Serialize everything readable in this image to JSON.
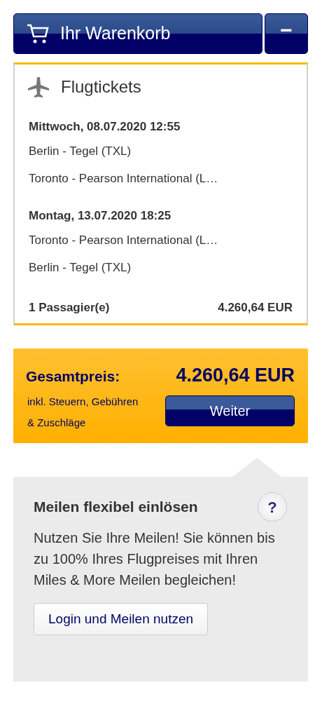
{
  "cart_header": {
    "title": "Ihr Warenkorb",
    "collapse_button": "−"
  },
  "flight_card": {
    "title": "Flugtickets",
    "segments": [
      {
        "datetime": "Mittwoch, 08.07.2020 12:55",
        "from": "Berlin - Tegel (TXL)",
        "to": "Toronto - Pearson International (L…"
      },
      {
        "datetime": "Montag, 13.07.2020 18:25",
        "from": "Toronto - Pearson International (L…",
        "to": "Berlin - Tegel (TXL)"
      }
    ],
    "passengers": "1 Passagier(e)",
    "price": "4.260,64 EUR"
  },
  "total": {
    "label": "Gesamtpreis:",
    "amount": "4.260,64 EUR",
    "note_line_1": "inkl. Steuern, Gebühren",
    "note_line_2": "& Zuschläge",
    "button": "Weiter"
  },
  "miles": {
    "title": "Meilen flexibel einlösen",
    "help": "?",
    "text": "Nutzen Sie Ihre Meilen! Sie können bis zu 100% Ihres Flugpreises mit Ihren Miles & More Meilen begleichen!",
    "button": "Login und Meilen nutzen"
  }
}
